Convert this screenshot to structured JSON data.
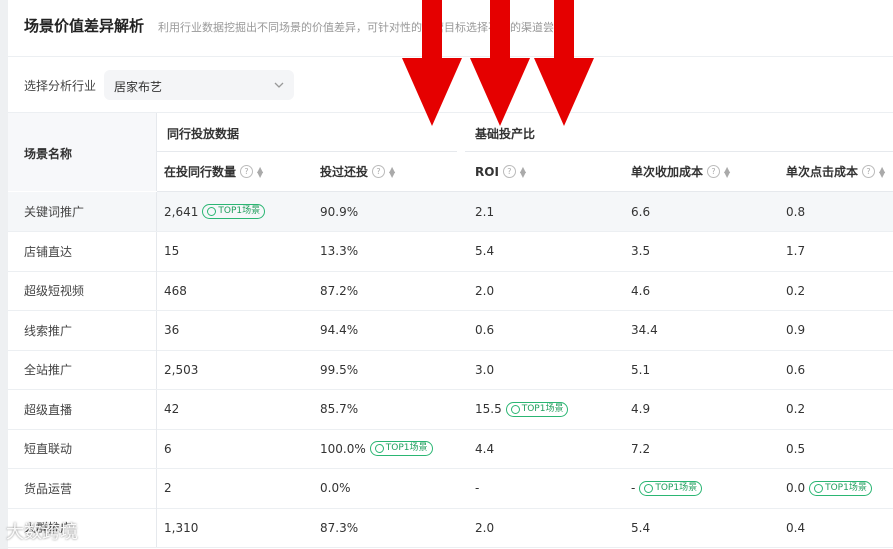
{
  "header": {
    "title": "场景价值差异解析",
    "subtitle": "利用行业数据挖掘出不同场景的价值差异，可针对性的经营目标选择不同的渠道尝试"
  },
  "filter": {
    "label": "选择分析行业",
    "value": "居家布艺"
  },
  "table": {
    "name_header": "场景名称",
    "group_headers": [
      "同行投放数据",
      "基础投产比"
    ],
    "columns": [
      "在投同行数量",
      "投过还投",
      "ROI",
      "单次收加成本",
      "单次点击成本"
    ],
    "badge_label": "TOP1场景",
    "rows": [
      {
        "name": "关键词推广",
        "cells": [
          "2,641",
          "90.9%",
          "2.1",
          "6.6",
          "0.8"
        ]
      },
      {
        "name": "店铺直达",
        "cells": [
          "15",
          "13.3%",
          "5.4",
          "3.5",
          "1.7"
        ]
      },
      {
        "name": "超级短视频",
        "cells": [
          "468",
          "87.2%",
          "2.0",
          "4.6",
          "0.2"
        ]
      },
      {
        "name": "线索推广",
        "cells": [
          "36",
          "94.4%",
          "0.6",
          "34.4",
          "0.9"
        ]
      },
      {
        "name": "全站推广",
        "cells": [
          "2,503",
          "99.5%",
          "3.0",
          "5.1",
          "0.6"
        ]
      },
      {
        "name": "超级直播",
        "cells": [
          "42",
          "85.7%",
          "15.5",
          "4.9",
          "0.2"
        ]
      },
      {
        "name": "短直联动",
        "cells": [
          "6",
          "100.0%",
          "4.4",
          "7.2",
          "0.5"
        ]
      },
      {
        "name": "货品运营",
        "cells": [
          "2",
          "0.0%",
          "-",
          "-",
          "0.0"
        ]
      },
      {
        "name": "人群推广",
        "cells": [
          "1,310",
          "87.3%",
          "2.0",
          "5.4",
          "0.4"
        ]
      }
    ]
  },
  "watermark": "大数跨境",
  "colors": {
    "arrow": "#e50000",
    "badge": "#2bb673",
    "highlight_row": "#f5f7f9"
  }
}
